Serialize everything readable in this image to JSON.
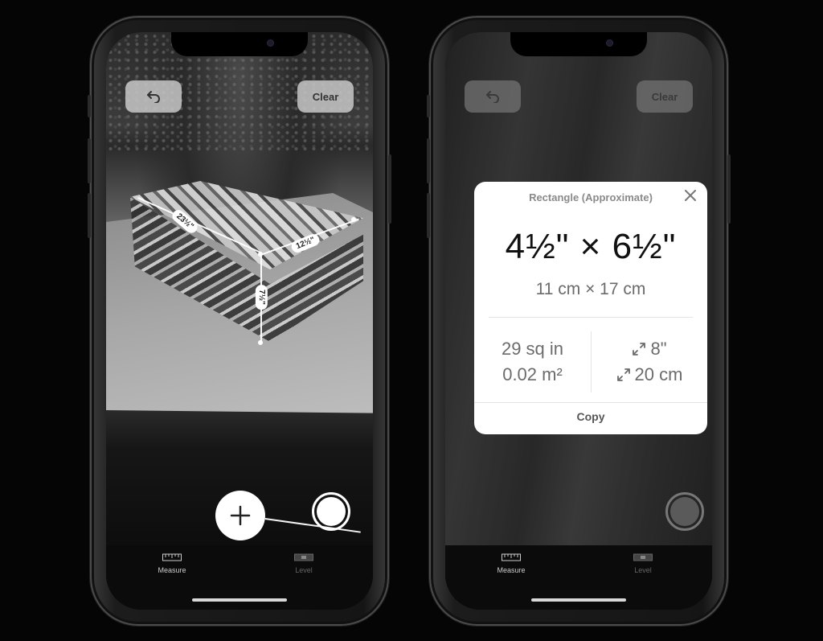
{
  "left_phone": {
    "undo_icon": "undo-arrow-icon",
    "clear_label": "Clear",
    "measurements": [
      "23½\"",
      "12½\"",
      "7½\""
    ],
    "add_icon": "plus-icon",
    "tabs": [
      {
        "label": "Measure",
        "icon": "ruler-icon",
        "active": true
      },
      {
        "label": "Level",
        "icon": "level-icon",
        "active": false
      }
    ]
  },
  "right_phone": {
    "undo_icon": "undo-arrow-icon",
    "clear_label": "Clear",
    "card": {
      "title": "Rectangle (Approximate)",
      "close_icon": "close-icon",
      "dimensions_imperial": "4½\" × 6½\"",
      "dimensions_metric": "11 cm × 17 cm",
      "area_imperial": "29 sq in",
      "area_metric": "0.02 m²",
      "diagonal_icon": "diagonal-arrows-icon",
      "diagonal_imperial": "8\"",
      "diagonal_metric": "20 cm",
      "copy_label": "Copy"
    },
    "tabs": [
      {
        "label": "Measure",
        "icon": "ruler-icon",
        "active": true
      },
      {
        "label": "Level",
        "icon": "level-icon",
        "active": false
      }
    ]
  },
  "colors": {
    "background": "#050505",
    "card": "#ffffff",
    "card_text": "#6b6b6b",
    "card_main_text": "#111111",
    "button_bg": "#c8c8c8"
  }
}
